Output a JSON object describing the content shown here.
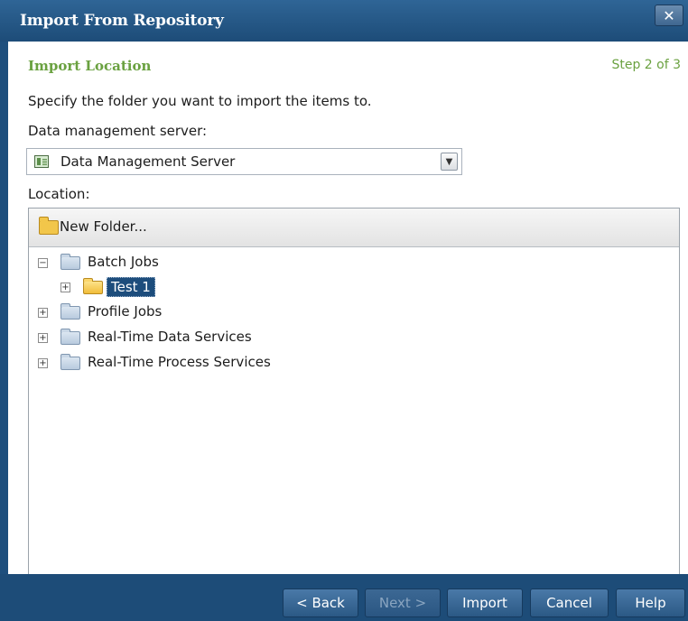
{
  "window": {
    "title": "Import From Repository",
    "close_label": "✕"
  },
  "header": {
    "section_title": "Import Location",
    "step": "Step 2 of 3"
  },
  "instructions": "Specify the folder you want to import the items to.",
  "server": {
    "label": "Data management server:",
    "selected": "Data Management Server",
    "icon": "server-icon"
  },
  "location": {
    "label": "Location:",
    "new_folder_label": "New Folder..."
  },
  "tree": [
    {
      "label": "Batch Jobs",
      "expanded": true,
      "expander": "−",
      "depth": 0,
      "selected": false,
      "icon": "folder-icon"
    },
    {
      "label": "Test 1",
      "expanded": false,
      "expander": "+",
      "depth": 1,
      "selected": true,
      "icon": "folder-open-icon"
    },
    {
      "label": "Profile Jobs",
      "expanded": false,
      "expander": "+",
      "depth": 0,
      "selected": false,
      "icon": "folder-icon"
    },
    {
      "label": "Real-Time Data Services",
      "expanded": false,
      "expander": "+",
      "depth": 0,
      "selected": false,
      "icon": "folder-icon"
    },
    {
      "label": "Real-Time Process Services",
      "expanded": false,
      "expander": "+",
      "depth": 0,
      "selected": false,
      "icon": "folder-icon"
    }
  ],
  "buttons": {
    "back": "< Back",
    "next": "Next >",
    "import": "Import",
    "cancel": "Cancel",
    "help": "Help"
  },
  "colors": {
    "accent_green": "#6aa140",
    "frame_blue": "#1d4c78",
    "selection_blue": "#1d4d7c"
  }
}
